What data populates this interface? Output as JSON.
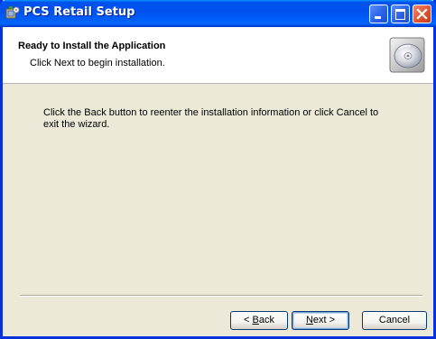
{
  "window": {
    "title": "PCS Retail Setup"
  },
  "titlebar": {
    "minimize_icon": "minimize-icon",
    "maximize_icon": "maximize-icon",
    "close_icon": "close-icon"
  },
  "header": {
    "title": "Ready to Install the Application",
    "subtitle": "Click Next to begin installation.",
    "icon": "cd-disc-icon"
  },
  "body": {
    "message": "Click the Back button to reenter the installation information or click Cancel to exit the wizard."
  },
  "buttons": {
    "back": {
      "pre": "< ",
      "accel": "B",
      "post": "ack"
    },
    "next": {
      "accel": "N",
      "post": "ext >"
    },
    "cancel": "Cancel"
  }
}
